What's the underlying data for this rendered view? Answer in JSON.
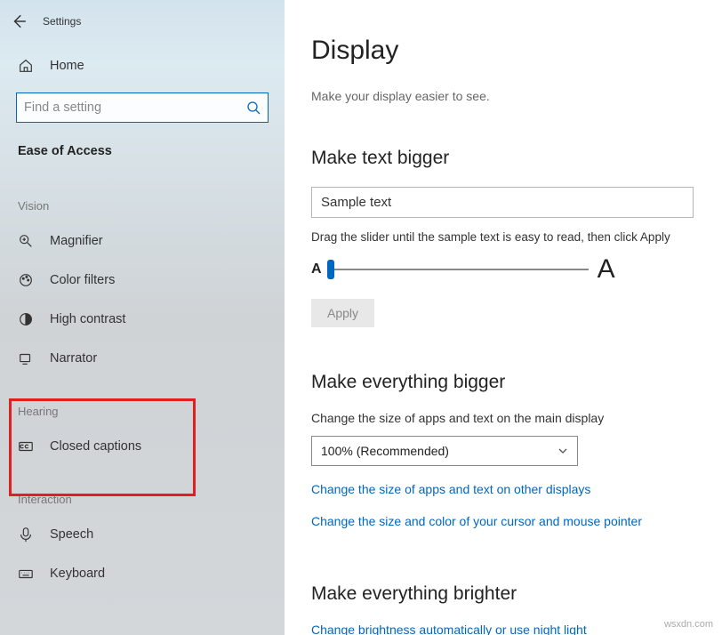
{
  "titlebar": {
    "label": "Settings"
  },
  "home": {
    "label": "Home"
  },
  "search": {
    "placeholder": "Find a setting"
  },
  "category": "Ease of Access",
  "groups": {
    "vision": {
      "label": "Vision",
      "items": [
        {
          "label": "Magnifier"
        },
        {
          "label": "Color filters"
        },
        {
          "label": "High contrast"
        },
        {
          "label": "Narrator"
        }
      ]
    },
    "hearing": {
      "label": "Hearing",
      "items": [
        {
          "label": "Closed captions"
        }
      ]
    },
    "interaction": {
      "label": "Interaction",
      "items": [
        {
          "label": "Speech"
        },
        {
          "label": "Keyboard"
        }
      ]
    }
  },
  "main": {
    "title": "Display",
    "subtitle": "Make your display easier to see.",
    "text_bigger": {
      "heading": "Make text bigger",
      "sample": "Sample text",
      "slider_desc": "Drag the slider until the sample text is easy to read, then click Apply",
      "letter_small": "A",
      "letter_big": "A",
      "apply": "Apply"
    },
    "everything_bigger": {
      "heading": "Make everything bigger",
      "desc": "Change the size of apps and text on the main display",
      "dropdown_value": "100% (Recommended)",
      "link1": "Change the size of apps and text on other displays",
      "link2": "Change the size and color of your cursor and mouse pointer"
    },
    "brighter": {
      "heading": "Make everything brighter",
      "link": "Change brightness automatically or use night light"
    }
  },
  "watermark": "wsxdn.com"
}
